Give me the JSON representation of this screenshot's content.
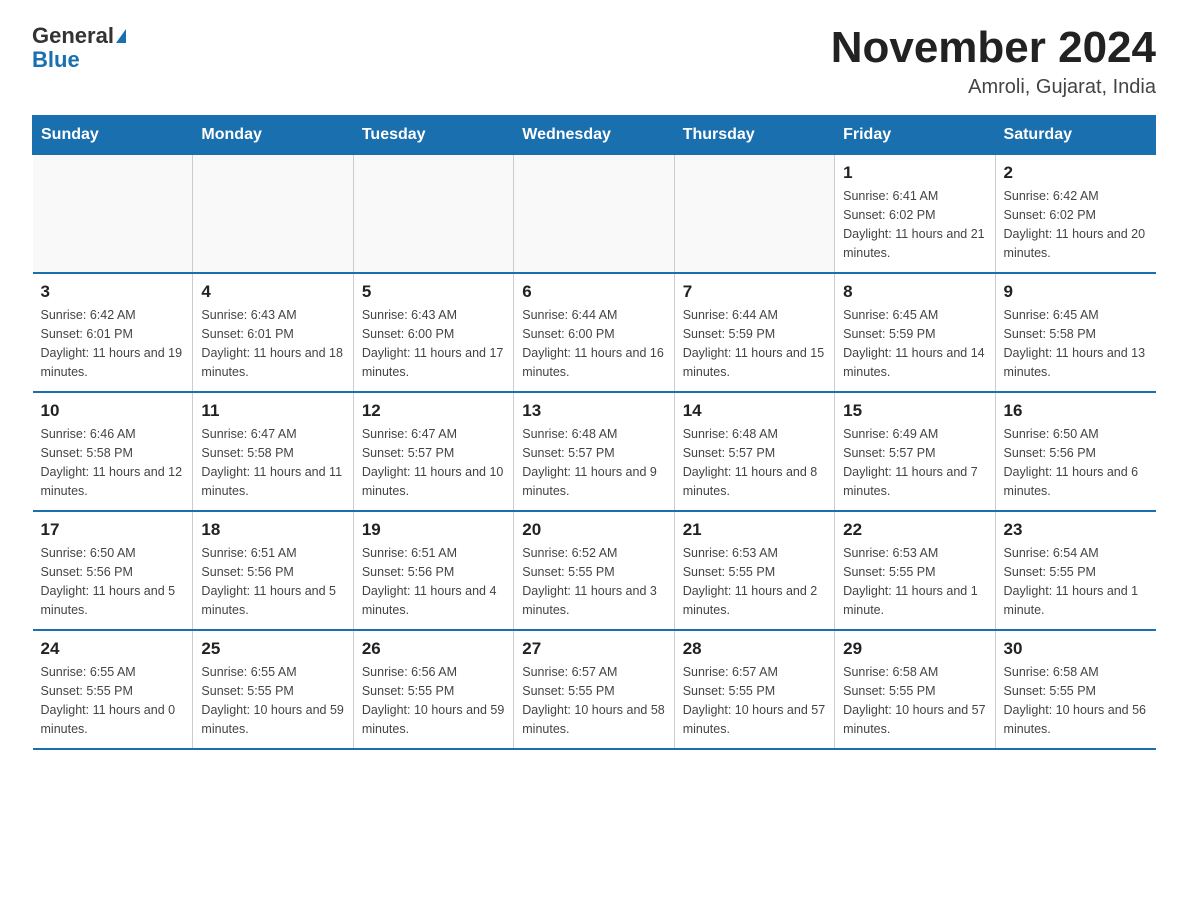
{
  "header": {
    "logo_general": "General",
    "logo_blue": "Blue",
    "title": "November 2024",
    "subtitle": "Amroli, Gujarat, India"
  },
  "weekdays": [
    "Sunday",
    "Monday",
    "Tuesday",
    "Wednesday",
    "Thursday",
    "Friday",
    "Saturday"
  ],
  "weeks": [
    [
      {
        "day": "",
        "info": ""
      },
      {
        "day": "",
        "info": ""
      },
      {
        "day": "",
        "info": ""
      },
      {
        "day": "",
        "info": ""
      },
      {
        "day": "",
        "info": ""
      },
      {
        "day": "1",
        "info": "Sunrise: 6:41 AM\nSunset: 6:02 PM\nDaylight: 11 hours and 21 minutes."
      },
      {
        "day": "2",
        "info": "Sunrise: 6:42 AM\nSunset: 6:02 PM\nDaylight: 11 hours and 20 minutes."
      }
    ],
    [
      {
        "day": "3",
        "info": "Sunrise: 6:42 AM\nSunset: 6:01 PM\nDaylight: 11 hours and 19 minutes."
      },
      {
        "day": "4",
        "info": "Sunrise: 6:43 AM\nSunset: 6:01 PM\nDaylight: 11 hours and 18 minutes."
      },
      {
        "day": "5",
        "info": "Sunrise: 6:43 AM\nSunset: 6:00 PM\nDaylight: 11 hours and 17 minutes."
      },
      {
        "day": "6",
        "info": "Sunrise: 6:44 AM\nSunset: 6:00 PM\nDaylight: 11 hours and 16 minutes."
      },
      {
        "day": "7",
        "info": "Sunrise: 6:44 AM\nSunset: 5:59 PM\nDaylight: 11 hours and 15 minutes."
      },
      {
        "day": "8",
        "info": "Sunrise: 6:45 AM\nSunset: 5:59 PM\nDaylight: 11 hours and 14 minutes."
      },
      {
        "day": "9",
        "info": "Sunrise: 6:45 AM\nSunset: 5:58 PM\nDaylight: 11 hours and 13 minutes."
      }
    ],
    [
      {
        "day": "10",
        "info": "Sunrise: 6:46 AM\nSunset: 5:58 PM\nDaylight: 11 hours and 12 minutes."
      },
      {
        "day": "11",
        "info": "Sunrise: 6:47 AM\nSunset: 5:58 PM\nDaylight: 11 hours and 11 minutes."
      },
      {
        "day": "12",
        "info": "Sunrise: 6:47 AM\nSunset: 5:57 PM\nDaylight: 11 hours and 10 minutes."
      },
      {
        "day": "13",
        "info": "Sunrise: 6:48 AM\nSunset: 5:57 PM\nDaylight: 11 hours and 9 minutes."
      },
      {
        "day": "14",
        "info": "Sunrise: 6:48 AM\nSunset: 5:57 PM\nDaylight: 11 hours and 8 minutes."
      },
      {
        "day": "15",
        "info": "Sunrise: 6:49 AM\nSunset: 5:57 PM\nDaylight: 11 hours and 7 minutes."
      },
      {
        "day": "16",
        "info": "Sunrise: 6:50 AM\nSunset: 5:56 PM\nDaylight: 11 hours and 6 minutes."
      }
    ],
    [
      {
        "day": "17",
        "info": "Sunrise: 6:50 AM\nSunset: 5:56 PM\nDaylight: 11 hours and 5 minutes."
      },
      {
        "day": "18",
        "info": "Sunrise: 6:51 AM\nSunset: 5:56 PM\nDaylight: 11 hours and 5 minutes."
      },
      {
        "day": "19",
        "info": "Sunrise: 6:51 AM\nSunset: 5:56 PM\nDaylight: 11 hours and 4 minutes."
      },
      {
        "day": "20",
        "info": "Sunrise: 6:52 AM\nSunset: 5:55 PM\nDaylight: 11 hours and 3 minutes."
      },
      {
        "day": "21",
        "info": "Sunrise: 6:53 AM\nSunset: 5:55 PM\nDaylight: 11 hours and 2 minutes."
      },
      {
        "day": "22",
        "info": "Sunrise: 6:53 AM\nSunset: 5:55 PM\nDaylight: 11 hours and 1 minute."
      },
      {
        "day": "23",
        "info": "Sunrise: 6:54 AM\nSunset: 5:55 PM\nDaylight: 11 hours and 1 minute."
      }
    ],
    [
      {
        "day": "24",
        "info": "Sunrise: 6:55 AM\nSunset: 5:55 PM\nDaylight: 11 hours and 0 minutes."
      },
      {
        "day": "25",
        "info": "Sunrise: 6:55 AM\nSunset: 5:55 PM\nDaylight: 10 hours and 59 minutes."
      },
      {
        "day": "26",
        "info": "Sunrise: 6:56 AM\nSunset: 5:55 PM\nDaylight: 10 hours and 59 minutes."
      },
      {
        "day": "27",
        "info": "Sunrise: 6:57 AM\nSunset: 5:55 PM\nDaylight: 10 hours and 58 minutes."
      },
      {
        "day": "28",
        "info": "Sunrise: 6:57 AM\nSunset: 5:55 PM\nDaylight: 10 hours and 57 minutes."
      },
      {
        "day": "29",
        "info": "Sunrise: 6:58 AM\nSunset: 5:55 PM\nDaylight: 10 hours and 57 minutes."
      },
      {
        "day": "30",
        "info": "Sunrise: 6:58 AM\nSunset: 5:55 PM\nDaylight: 10 hours and 56 minutes."
      }
    ]
  ]
}
